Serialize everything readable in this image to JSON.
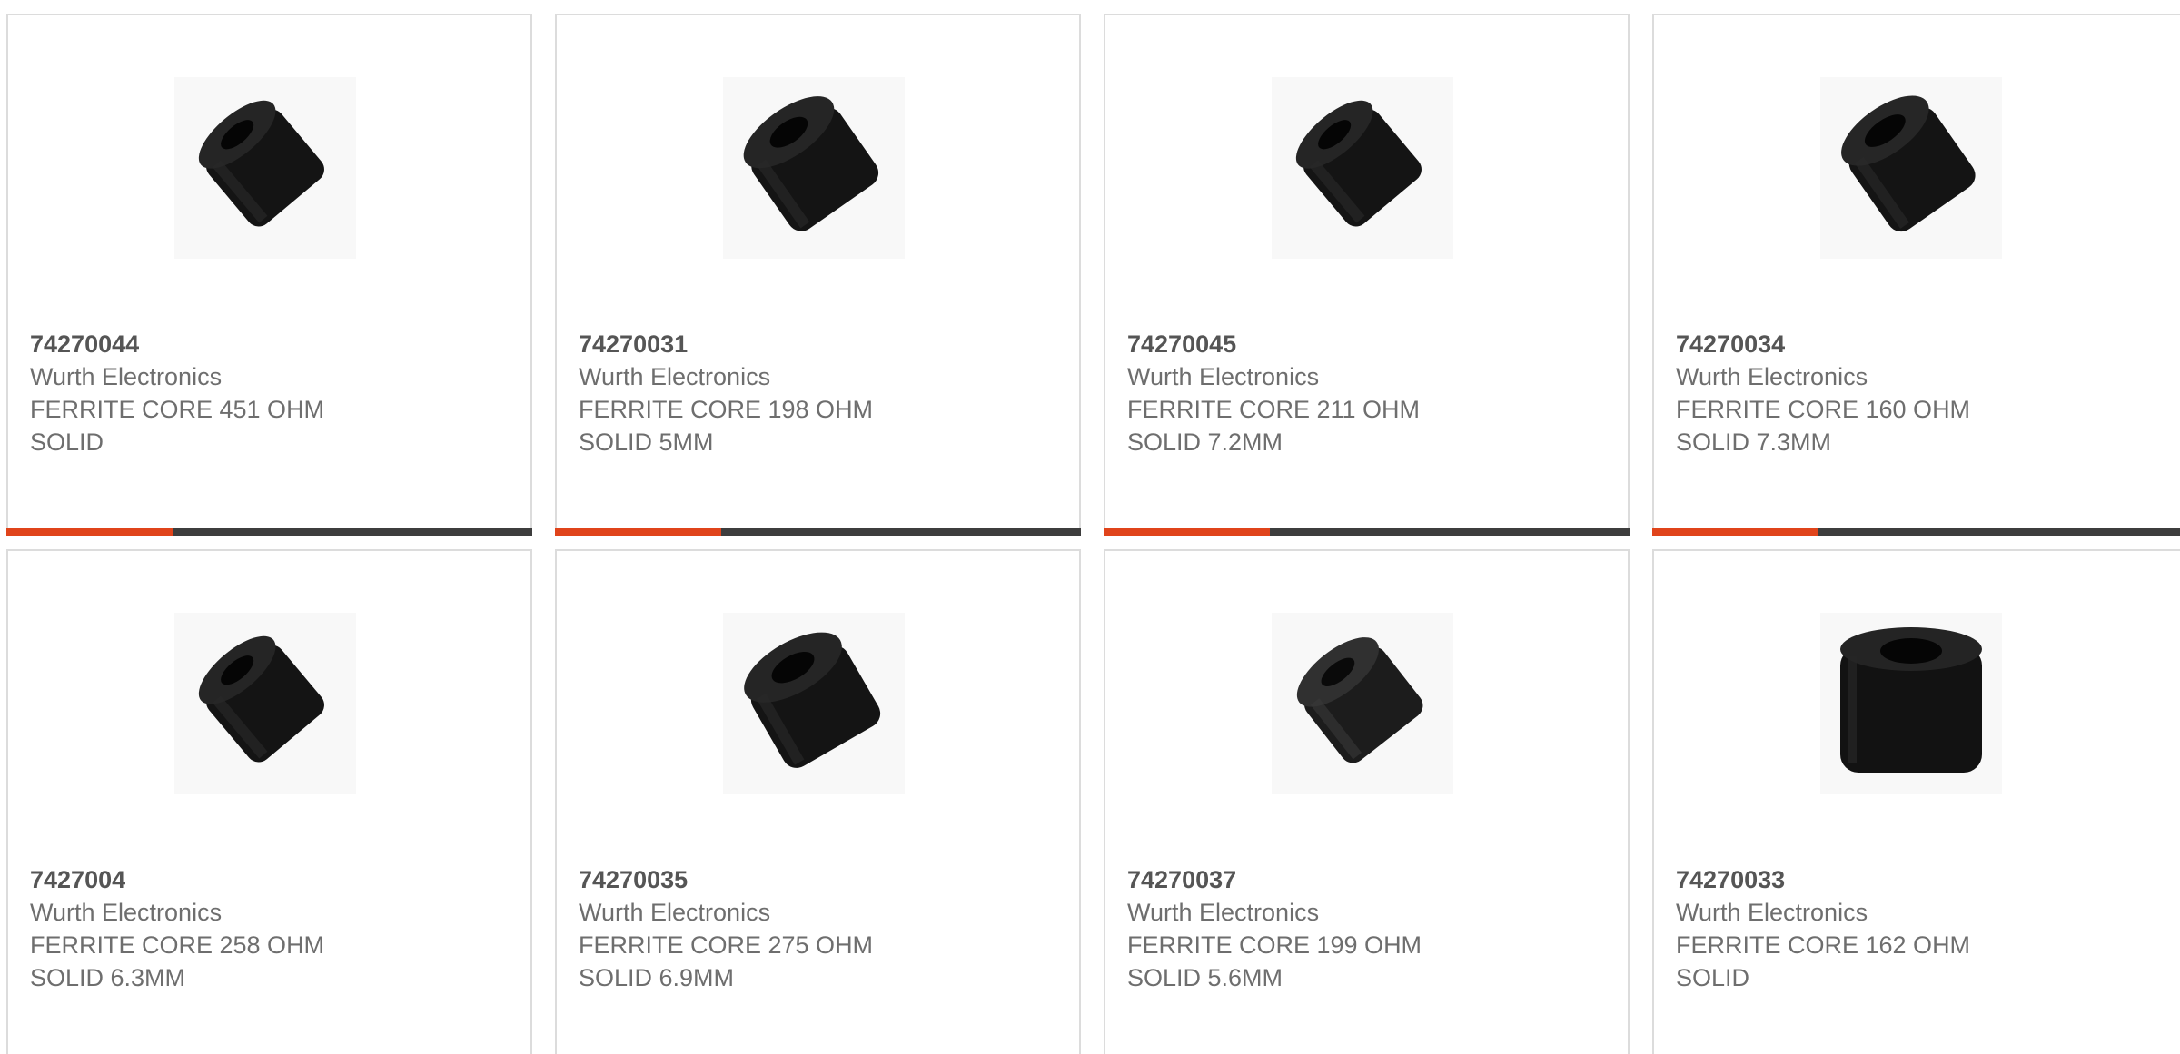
{
  "theme": {
    "accent": "#e0441b",
    "bar": "#3d3d3d",
    "border": "#dcdcdc",
    "text": "#6e6e6e"
  },
  "products": [
    {
      "part": "74270044",
      "manufacturer": "Wurth Electronics",
      "desc1": "FERRITE CORE 451 OHM",
      "desc2": "SOLID",
      "icon": "ferrite-core-icon"
    },
    {
      "part": "74270031",
      "manufacturer": "Wurth Electronics",
      "desc1": "FERRITE CORE 198 OHM",
      "desc2": "SOLID 5MM",
      "icon": "ferrite-core-icon"
    },
    {
      "part": "74270045",
      "manufacturer": "Wurth Electronics",
      "desc1": "FERRITE CORE 211 OHM",
      "desc2": "SOLID 7.2MM",
      "icon": "ferrite-core-icon"
    },
    {
      "part": "74270034",
      "manufacturer": "Wurth Electronics",
      "desc1": "FERRITE CORE 160 OHM",
      "desc2": "SOLID 7.3MM",
      "icon": "ferrite-core-icon"
    },
    {
      "part": "7427004",
      "manufacturer": "Wurth Electronics",
      "desc1": "FERRITE CORE 258 OHM",
      "desc2": "SOLID 6.3MM",
      "icon": "ferrite-core-icon"
    },
    {
      "part": "74270035",
      "manufacturer": "Wurth Electronics",
      "desc1": "FERRITE CORE 275 OHM",
      "desc2": "SOLID 6.9MM",
      "icon": "ferrite-core-icon"
    },
    {
      "part": "74270037",
      "manufacturer": "Wurth Electronics",
      "desc1": "FERRITE CORE 199 OHM",
      "desc2": "SOLID 5.6MM",
      "icon": "ferrite-core-icon"
    },
    {
      "part": "74270033",
      "manufacturer": "Wurth Electronics",
      "desc1": "FERRITE CORE 162 OHM",
      "desc2": "SOLID",
      "icon": "ferrite-core-front-icon"
    }
  ]
}
